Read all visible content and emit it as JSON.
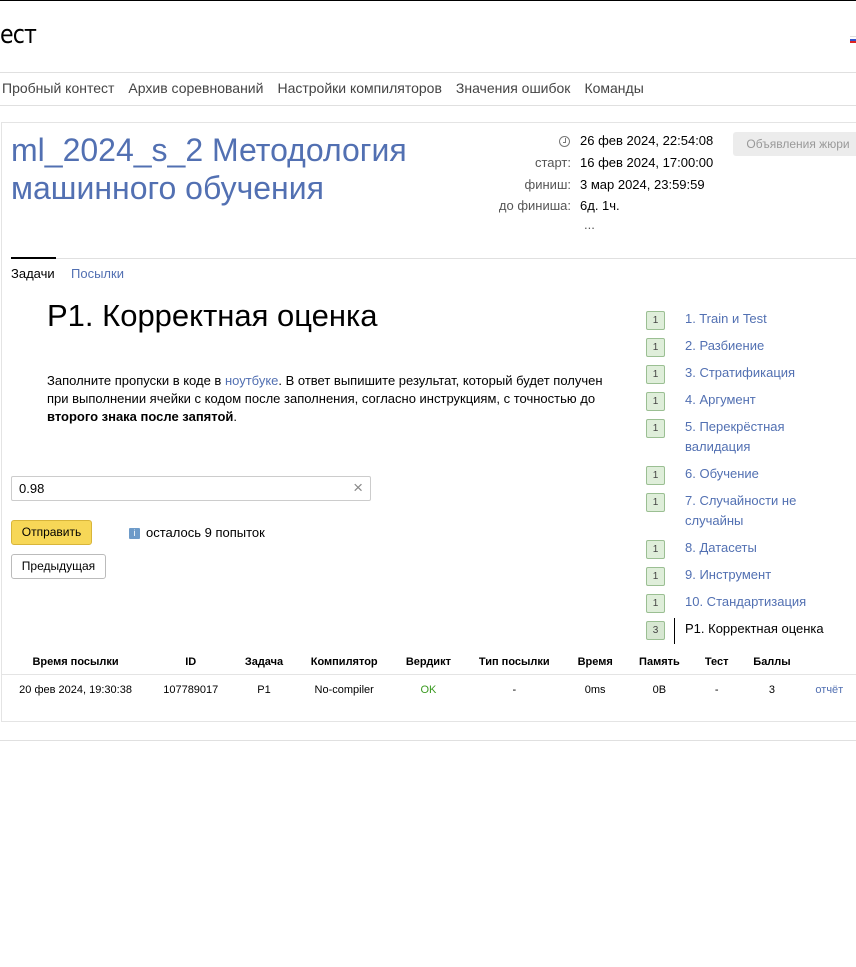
{
  "header": {
    "logo_text": "ест",
    "nav": [
      "Пробный контест",
      "Архив соревнований",
      "Настройки компиляторов",
      "Значения ошибок",
      "Команды"
    ]
  },
  "contest": {
    "title": "ml_2024_s_2 Методология машинного обучения",
    "current_time": "26 фев 2024, 22:54:08",
    "start_label": "старт:",
    "start_value": "16 фев 2024, 17:00:00",
    "finish_label": "финиш:",
    "finish_value": "3 мар 2024, 23:59:59",
    "remaining_label": "до финиша:",
    "remaining_value": "6д. 1ч.",
    "ellipsis": "...",
    "jury_button": "Объявления жюри"
  },
  "tabs": {
    "active": "Задачи",
    "other": "Посылки"
  },
  "problem": {
    "title": "P1. Корректная оценка",
    "text_before_link": "Заполните пропуски в коде в ",
    "link_text": "ноутбуке",
    "text_after_link": ". В ответ выпишите результат, который будет получен при выполнении ячейки с кодом после заполнения, согласно инструкциям, с точностью до ",
    "bold_text": "второго знака после запятой",
    "text_end": ".",
    "answer_value": "0.98",
    "clear_glyph": "×",
    "send_button": "Отправить",
    "attempts_icon": "i",
    "attempts_text": "осталось 9 попыток",
    "prev_button": "Предыдущая"
  },
  "problem_list": [
    {
      "score": "1",
      "name": "1. Train и Test",
      "lines": 1
    },
    {
      "score": "1",
      "name": "2. Разбиение",
      "lines": 1
    },
    {
      "score": "1",
      "name": "3. Стратификация",
      "lines": 1
    },
    {
      "score": "1",
      "name": "4. Аргумент",
      "lines": 1
    },
    {
      "score": "1",
      "name": "5. Перекрёстная валидация",
      "lines": 2
    },
    {
      "score": "1",
      "name": "6. Обучение",
      "lines": 1
    },
    {
      "score": "1",
      "name": "7. Случайности не случайны",
      "lines": 2
    },
    {
      "score": "1",
      "name": "8. Датасеты",
      "lines": 1
    },
    {
      "score": "1",
      "name": "9. Инструмент",
      "lines": 1
    },
    {
      "score": "1",
      "name": "10. Стандартизация",
      "lines": 1
    },
    {
      "score": "3",
      "name": "P1. Корректная оценка",
      "lines": 1,
      "current": true
    }
  ],
  "submissions": {
    "headers": [
      "Время посылки",
      "ID",
      "Задача",
      "Компилятор",
      "Вердикт",
      "Тип посылки",
      "Время",
      "Память",
      "Тест",
      "Баллы",
      ""
    ],
    "rows": [
      [
        "20 фев 2024, 19:30:38",
        "107789017",
        "P1",
        "No-compiler",
        "OK",
        "-",
        "0ms",
        "0B",
        "-",
        "3",
        "отчёт"
      ]
    ]
  },
  "colors": {
    "link": "#5270b2",
    "accent_button": "#f7d757",
    "ok": "#3a9a20"
  }
}
